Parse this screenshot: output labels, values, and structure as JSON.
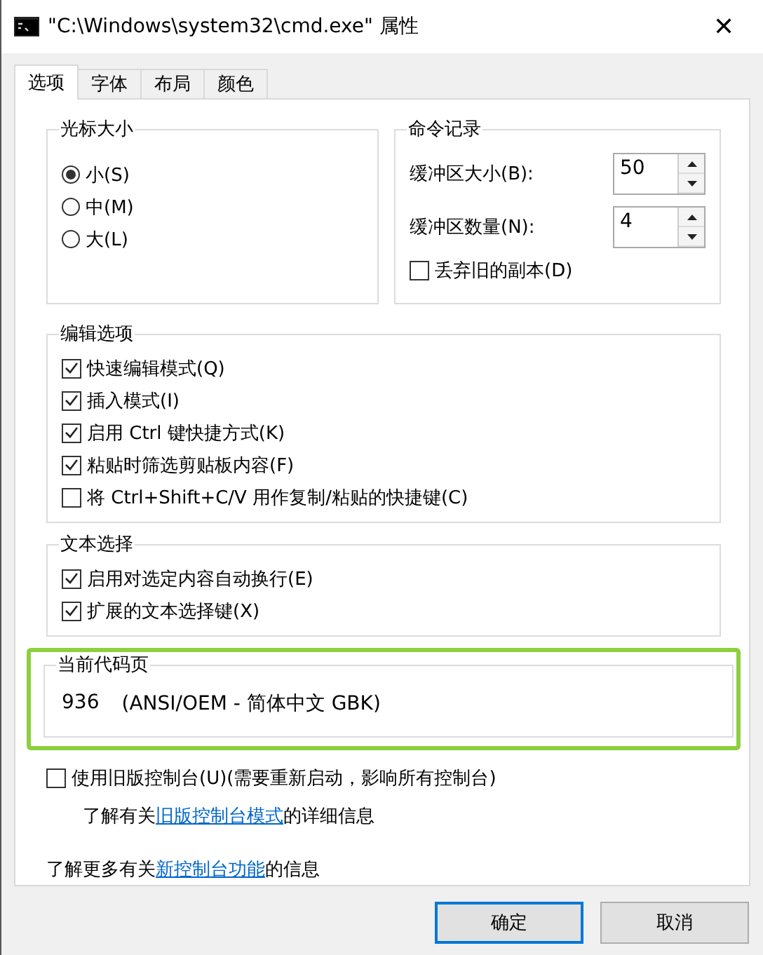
{
  "window": {
    "title": "\"C:\\Windows\\system32\\cmd.exe\" 属性",
    "close": "✕"
  },
  "tabs": [
    {
      "label": "选项",
      "selected": true
    },
    {
      "label": "字体",
      "selected": false
    },
    {
      "label": "布局",
      "selected": false
    },
    {
      "label": "颜色",
      "selected": false
    }
  ],
  "cursor_size": {
    "title": "光标大小",
    "options": [
      {
        "label": "小(S)",
        "selected": true
      },
      {
        "label": "中(M)",
        "selected": false
      },
      {
        "label": "大(L)",
        "selected": false
      }
    ]
  },
  "command_history": {
    "title": "命令记录",
    "spinners": [
      {
        "label": "缓冲区大小(B):",
        "value": "50"
      },
      {
        "label": "缓冲区数量(N):",
        "value": "4"
      }
    ],
    "discard": {
      "label": "丢弃旧的副本(D)",
      "checked": false
    }
  },
  "edit_options": {
    "title": "编辑选项",
    "items": [
      {
        "label": "快速编辑模式(Q)",
        "checked": true
      },
      {
        "label": "插入模式(I)",
        "checked": true
      },
      {
        "label": "启用 Ctrl 键快捷方式(K)",
        "checked": true
      },
      {
        "label": "粘贴时筛选剪贴板内容(F)",
        "checked": true
      },
      {
        "label": "将 Ctrl+Shift+C/V 用作复制/粘贴的快捷键(C)",
        "checked": false
      }
    ]
  },
  "text_selection": {
    "title": "文本选择",
    "items": [
      {
        "label": "启用对选定内容自动换行(E)",
        "checked": true
      },
      {
        "label": "扩展的文本选择键(X)",
        "checked": true
      }
    ]
  },
  "code_page": {
    "title": "当前代码页",
    "number": "936",
    "value": "(ANSI/OEM - 简体中文 GBK)",
    "highlighted": true
  },
  "legacy": {
    "label": "使用旧版控制台(U)(需要重新启动，影响所有控制台)",
    "checked": false,
    "info": {
      "before": "了解有关",
      "link": "旧版控制台模式",
      "after": "的详细信息"
    }
  },
  "more_info": {
    "before": "了解更多有关",
    "link": "新控制台功能",
    "after": "的信息"
  },
  "buttons": [
    {
      "label": "确定",
      "default": true
    },
    {
      "label": "取消",
      "default": false
    }
  ]
}
